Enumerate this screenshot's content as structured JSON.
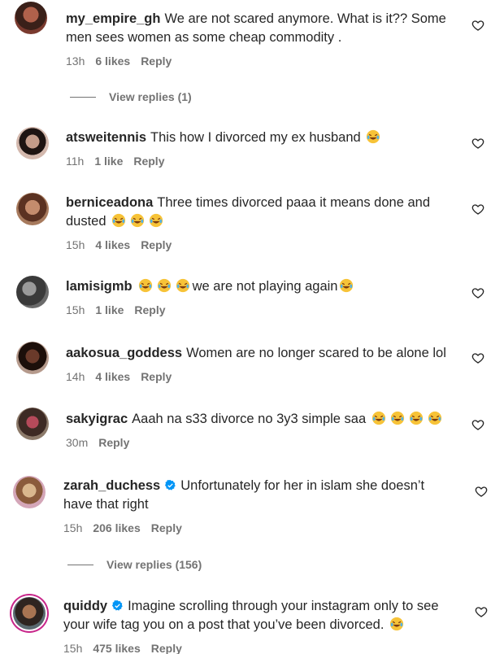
{
  "icons": {
    "like": "heart-outline-icon",
    "verified": "verified-badge-icon",
    "emoji": "rolling-on-floor-laughing-emoji"
  },
  "colors": {
    "text": "#262626",
    "muted": "#737373",
    "verified": "#0095f6",
    "story_ring": "#c8268a"
  },
  "comments": [
    {
      "username": "my_empire_gh",
      "text": "We are not scared anymore. What is it?? Some men sees women as some cheap commodity .",
      "emoji_count": 0,
      "time": "13h",
      "likes": "6 likes",
      "reply": "Reply",
      "view_replies": "View replies (1)",
      "verified": false
    },
    {
      "username": "atsweitennis",
      "text": "This how I divorced my ex husband",
      "emoji_count": 1,
      "time": "11h",
      "likes": "1 like",
      "reply": "Reply",
      "verified": false
    },
    {
      "username": "berniceadona",
      "text": "Three times divorced paaa it means done and dusted",
      "emoji_count": 3,
      "time": "15h",
      "likes": "4 likes",
      "reply": "Reply",
      "verified": false
    },
    {
      "username": "lamisigmb",
      "text": "we are not playing again",
      "emoji_count_before": 3,
      "emoji_count": 1,
      "time": "15h",
      "likes": "1 like",
      "reply": "Reply",
      "verified": false
    },
    {
      "username": "aakosua_goddess",
      "text": "Women are no longer scared to be alone lol",
      "emoji_count": 0,
      "time": "14h",
      "likes": "4 likes",
      "reply": "Reply",
      "verified": false
    },
    {
      "username": "sakyigrac",
      "text": "Aaah na s33 divorce no 3y3 simple saa",
      "emoji_count": 4,
      "time": "30m",
      "likes": "",
      "reply": "Reply",
      "verified": false
    },
    {
      "username": "zarah_duchess",
      "text": "Unfortunately for her in islam she doesn’t have that right",
      "emoji_count": 0,
      "time": "15h",
      "likes": "206 likes",
      "reply": "Reply",
      "view_replies": "View replies (156)",
      "verified": true
    },
    {
      "username": "quiddy",
      "text": "Imagine scrolling through your instagram only to see your wife tag you on a post that you’ve been divorced.",
      "emoji_count": 1,
      "time": "15h",
      "likes": "475 likes",
      "reply": "Reply",
      "verified": true
    }
  ]
}
